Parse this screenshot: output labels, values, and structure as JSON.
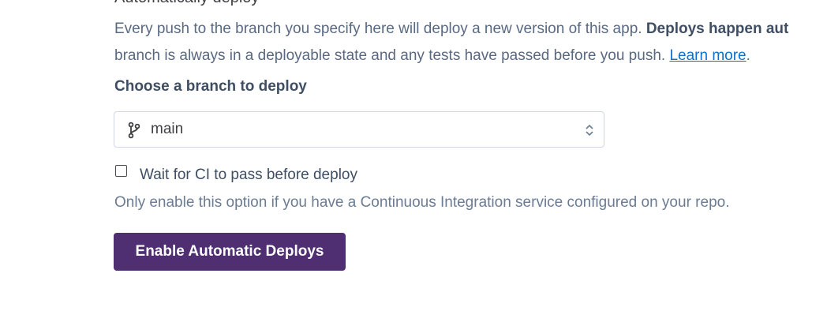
{
  "section": {
    "clipped_heading": "Automatically deploy"
  },
  "description": {
    "text_before_bold": "Every push to the branch you specify here will deploy a new version of this app. ",
    "bold_text": "Deploys happen aut",
    "text_line2": "branch is always in a deployable state and any tests have passed before you push. ",
    "learn_more_link": "Learn more",
    "trailing": "."
  },
  "branch": {
    "label": "Choose a branch to deploy",
    "selected": "main",
    "icon": "git-branch-icon",
    "chevron_icon": "select-chevrons-icon"
  },
  "ci": {
    "checkbox_label": "Wait for CI to pass before deploy",
    "checked": false,
    "hint": "Only enable this option if you have a Continuous Integration service configured on your repo."
  },
  "actions": {
    "enable_label": "Enable Automatic Deploys",
    "button_color": "#4f2e72"
  },
  "colors": {
    "link": "#0e71c9",
    "text": "#596981",
    "heading": "#3f4e63"
  }
}
